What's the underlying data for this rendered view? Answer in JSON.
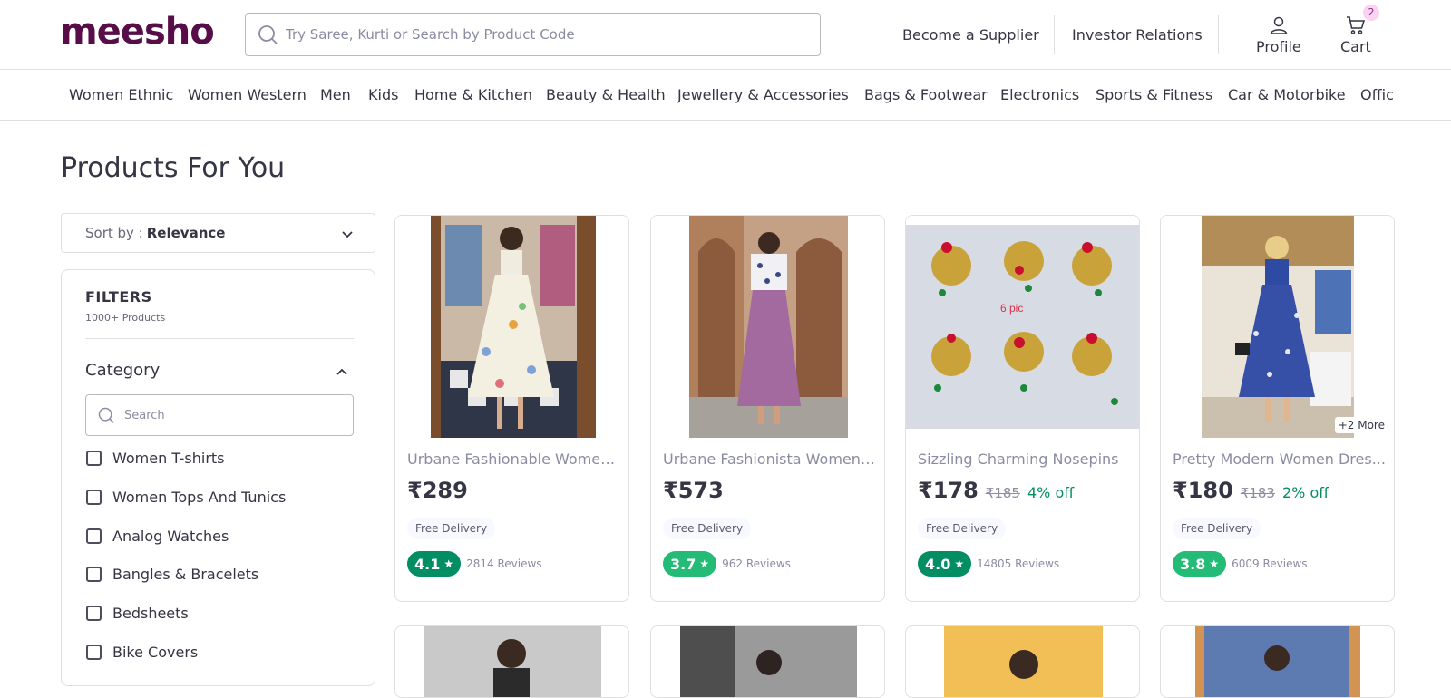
{
  "header": {
    "logo": "meesho",
    "search_placeholder": "Try Saree, Kurti or Search by Product Code",
    "become_supplier": "Become a Supplier",
    "investor_relations": "Investor Relations",
    "profile_label": "Profile",
    "cart_label": "Cart",
    "cart_count": "2"
  },
  "categories": [
    "Women Ethnic",
    "Women Western",
    "Men",
    "Kids",
    "Home & Kitchen",
    "Beauty & Health",
    "Jewellery & Accessories",
    "Bags & Footwear",
    "Electronics",
    "Sports & Fitness",
    "Car & Motorbike",
    "Offic"
  ],
  "main": {
    "title": "Products For You"
  },
  "sort": {
    "label": "Sort by :",
    "value": "Relevance"
  },
  "filters": {
    "title": "FILTERS",
    "count": "1000+ Products",
    "category_title": "Category",
    "search_placeholder": "Search",
    "options": [
      "Women T-shirts",
      "Women Tops And Tunics",
      "Analog Watches",
      "Bangles & Bracelets",
      "Bedsheets",
      "Bike Covers"
    ]
  },
  "products": [
    {
      "name": "Urbane Fashionable Women...",
      "price": "₹289",
      "mrp": "",
      "off": "",
      "delivery": "Free Delivery",
      "rating": "4.1",
      "rating_color": "#038d63",
      "reviews": "2814 Reviews"
    },
    {
      "name": "Urbane Fashionista Women ...",
      "price": "₹573",
      "mrp": "",
      "off": "",
      "delivery": "Free Delivery",
      "rating": "3.7",
      "rating_color": "#23bb75",
      "reviews": "962 Reviews"
    },
    {
      "name": "Sizzling Charming Nosepins",
      "price": "₹178",
      "mrp": "₹185",
      "off": "4% off",
      "delivery": "Free Delivery",
      "rating": "4.0",
      "rating_color": "#038d63",
      "reviews": "14805 Reviews",
      "image_caption": "6 pic"
    },
    {
      "name": "Pretty Modern Women Dres...",
      "price": "₹180",
      "mrp": "₹183",
      "off": "2% off",
      "delivery": "Free Delivery",
      "rating": "3.8",
      "rating_color": "#23bb75",
      "reviews": "6009 Reviews",
      "more_badge": "+2 More"
    }
  ],
  "colors": {
    "brand": "#570d48",
    "green_dark": "#038d63",
    "green_light": "#23bb75"
  }
}
